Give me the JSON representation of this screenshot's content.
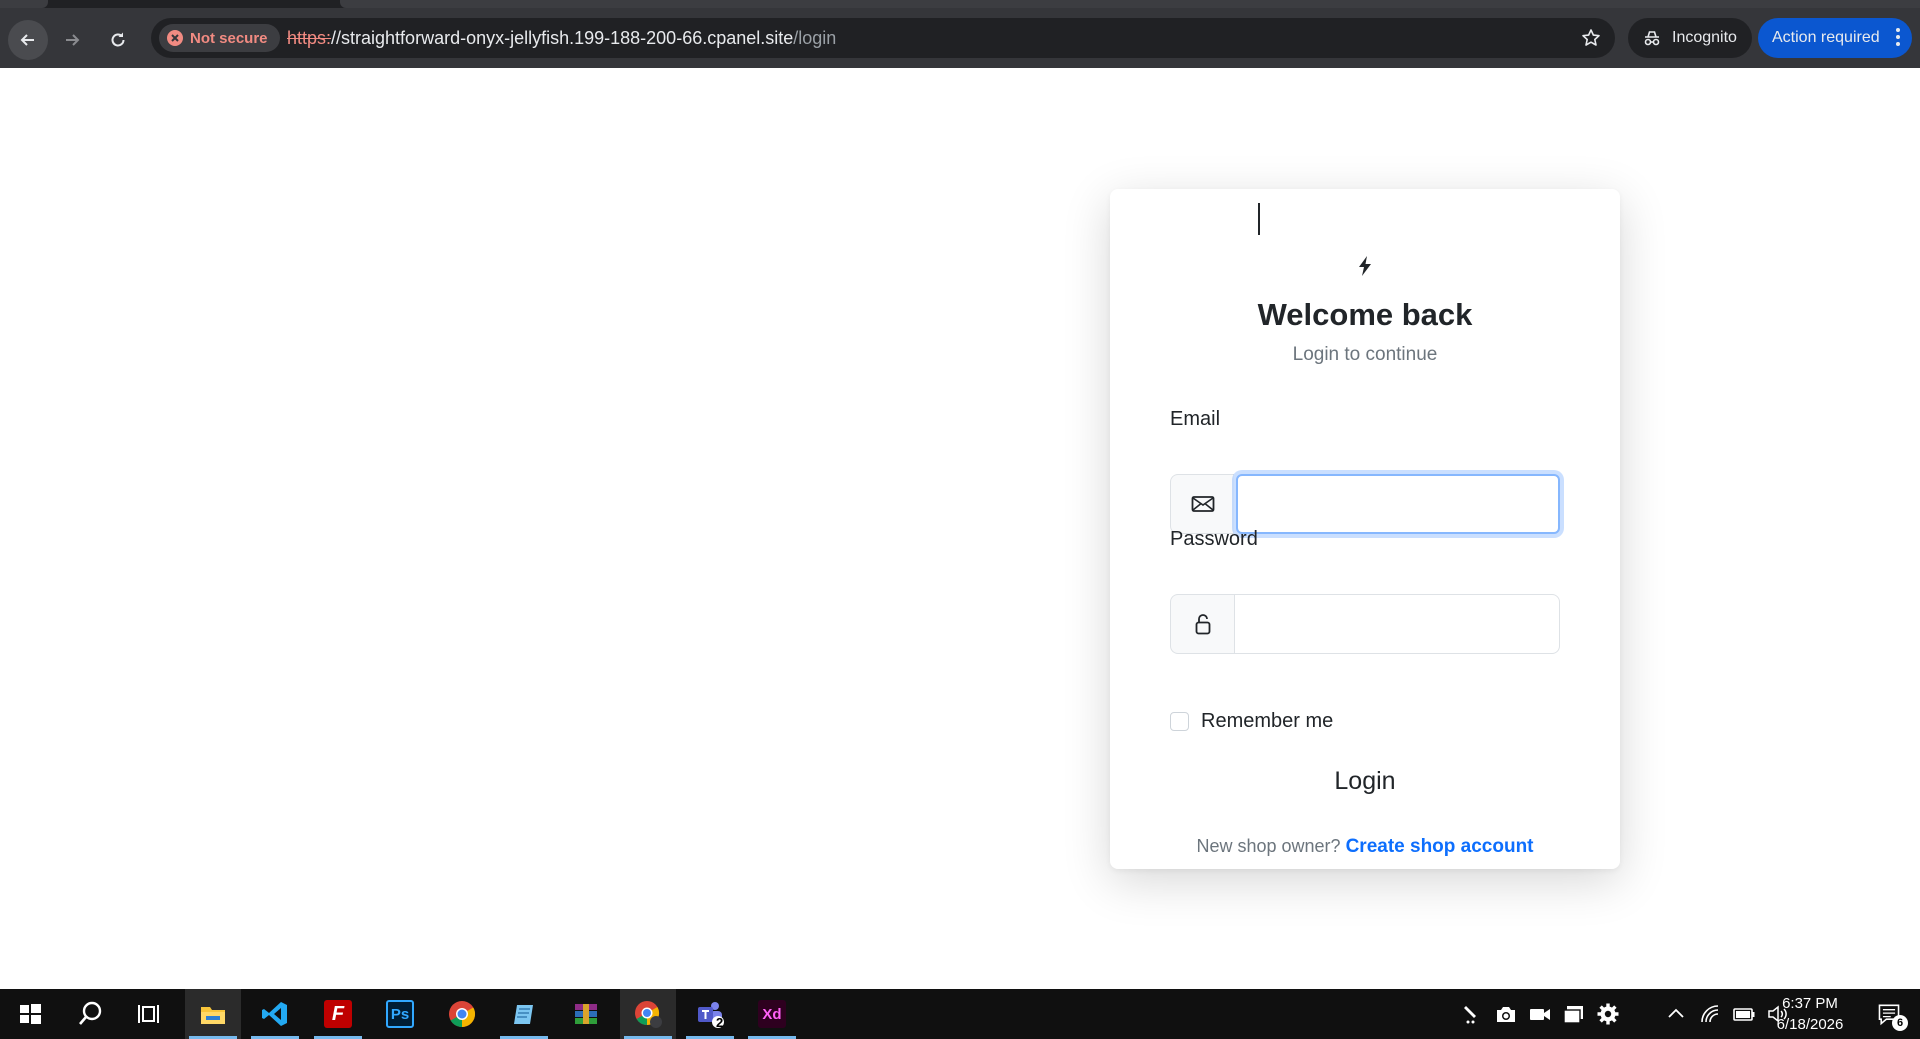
{
  "browser": {
    "security_label": "Not secure",
    "url_scheme": "https:",
    "url_host": "//straightforward-onyx-jellyfish.199-188-200-66.cpanel.site",
    "url_path": "/login",
    "incognito_label": "Incognito",
    "action_label": "Action required",
    "action_color": "#0b57d0"
  },
  "login": {
    "title": "Welcome back",
    "subtitle": "Login to continue",
    "email_label": "Email",
    "email_value": "",
    "password_label": "Password",
    "password_value": "",
    "remember_label": "Remember me",
    "remember_checked": false,
    "login_button": "Login",
    "signup_prompt": "New shop owner?",
    "signup_link": "Create shop account",
    "link_color": "#0d6efd"
  },
  "taskbar": {
    "apps": [
      "start-icon",
      "search-icon",
      "task-view-icon",
      "file-explorer-icon",
      "vscode-icon",
      "filezilla-icon",
      "photoshop-icon",
      "chrome-icon",
      "notepad-icon",
      "winrar-icon",
      "chrome-incognito-icon",
      "teams-icon",
      "adobe-xd-icon"
    ],
    "photoshop_label": "Ps",
    "xd_label": "Xd",
    "teams_badge": "2",
    "time": "6:37 PM",
    "date": "6/18/2026",
    "notification_count": "6"
  }
}
